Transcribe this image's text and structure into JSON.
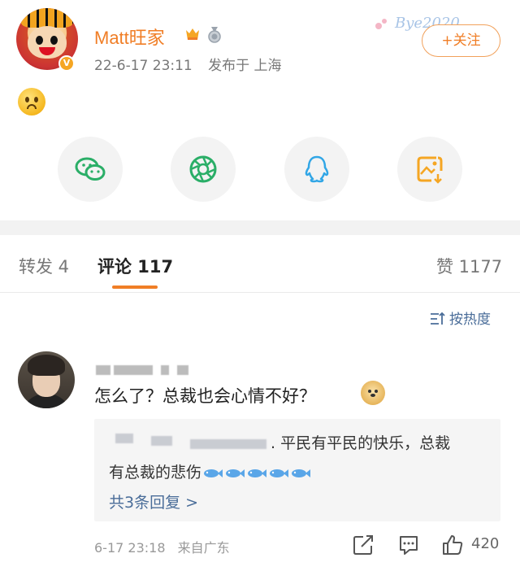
{
  "post": {
    "username": "Matt旺家",
    "date": "22-6-17 23:11",
    "location": "发布于 上海",
    "follow_label": "+关注",
    "decor_text": "Bye2020"
  },
  "share_icons": [
    "wechat-icon",
    "moments-icon",
    "qq-icon",
    "save-image-icon"
  ],
  "tabs": {
    "repost": "转发 4",
    "comment": "评论 117",
    "like": "赞 1177"
  },
  "sort_label": "按热度",
  "comment": {
    "text": "怎么了？总裁也会心情不好？",
    "reply_line1": ". 平民有平民的快乐，总裁",
    "reply_line2": "有总裁的悲伤",
    "reply_more": "共3条回复 >",
    "time": "6-17 23:18",
    "source": "来自广东",
    "likes": "420"
  },
  "colors": {
    "accent": "#f07e26",
    "link": "#4a6d99",
    "muted": "#999999"
  }
}
